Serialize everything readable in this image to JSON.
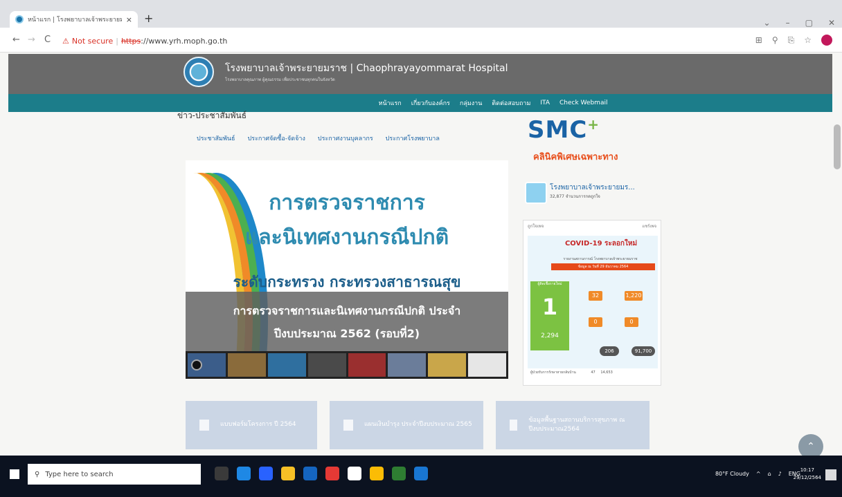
{
  "browser": {
    "tab_title": "หน้าแรก | โรงพยาบาลเจ้าพระยายมราช",
    "tab_close": "×",
    "new_tab": "+",
    "win_controls": [
      "⌄",
      "–",
      "▢",
      "✕"
    ],
    "nav": {
      "back": "←",
      "forward": "→",
      "reload": "C"
    },
    "security_icon": "⚠",
    "not_secure": "Not secure",
    "https": "https",
    "url": "://www.yrh.moph.go.th",
    "addr_icons": [
      "⊞",
      "⚲",
      "⎘",
      "☆"
    ]
  },
  "site": {
    "title": "โรงพยาบาลเจ้าพระยายมราช | Chaophrayayommarat Hospital",
    "subtitle": "โรงพยาบาลคุณภาพ ผู้คุณธรรม เพื่อประชาชนทุกคนในจังหวัด",
    "menu": [
      "หน้าแรก",
      "เกี่ยวกับองค์กร",
      "กลุ่มงาน",
      "ติดต่อสอบถาม",
      "ITA",
      "Check Webmail"
    ]
  },
  "news": {
    "heading": "ข่าว-ประชาสัมพันธ์",
    "tabs": [
      "ประชาสัมพันธ์",
      "ประกาศจัดซื้อ-จัดจ้าง",
      "ประกาศงานบุคลากร",
      "ประกาศโรงพยาบาล"
    ]
  },
  "slide": {
    "title_line1": "การตรวจราชการ",
    "title_line2": "และนิเทศงานกรณีปกติ",
    "subline": "ระดับกระทรวง กระทรวงสาธารณสุข",
    "caption_line1": "การตรวจราชการและนิเทศงานกรณีปกติ ประจำ",
    "caption_line2": "ปีงบประมาณ 2562 (รอบที่2)",
    "prev_arrow": "‹",
    "thumb_colors": [
      "#3b5d8a",
      "#8a6b3b",
      "#2f6f9f",
      "#4a4a4a",
      "#9a2f2f",
      "#6b7d9a",
      "#c9a64a",
      "#e6e6e6"
    ]
  },
  "sidebar": {
    "smc_logo": "SMC",
    "smc_plus": "+",
    "smc_sub": "คลินิคพิเศษเฉพาะทาง",
    "fb_page_name": "โรงพยาบาลเจ้าพระยายมร...",
    "fb_likes": "32,877 จำนวนการกดถูกใจ",
    "fb_like_btn": "ถูกใจเพจ",
    "fb_share_btn": "แชร์เพจ",
    "covid_title": "COVID-19 ระลอกใหม่",
    "covid_mini": "รายงานสถานการณ์ โรงพยาบาลเจ้าพระยายมราช",
    "covid_red": "ข้อมูล ณ วันที่ 29 ธันวาคม 2564",
    "covid_new": "1",
    "covid_new_label": "ผู้ติดเชื้อรายใหม่",
    "covid_total": "2,294",
    "boxes": [
      "32",
      "1,220",
      "0",
      "0"
    ],
    "pills": [
      "206",
      "91,700"
    ],
    "footer_text": "ผู้ป่วยรับการรักษาหายกลับบ้าน",
    "footer_vals": [
      "47",
      "14,653"
    ]
  },
  "tiles": [
    "แบบฟอร์มโครงการ ปี 2564",
    "แผนเงินบำรุง ประจำปีงบประมาณ 2565",
    "ข้อมูลพื้นฐานสถานบริการสุขภาพ ณ ปีงบประมาณ2564"
  ],
  "scroll_top": "⌃",
  "taskbar": {
    "search_icon": "⚲",
    "search_placeholder": "Type here to search",
    "weather": "80°F Cloudy",
    "lang": "ENG",
    "time": "10:17",
    "date": "29/12/2564",
    "app_colors": [
      "#3a3a3a",
      "#1e88e5",
      "#2962ff",
      "#f6c026",
      "#1565c0",
      "#e53935",
      "#ffffff",
      "#fbbc05",
      "#2e7d32",
      "#1976d2"
    ]
  }
}
